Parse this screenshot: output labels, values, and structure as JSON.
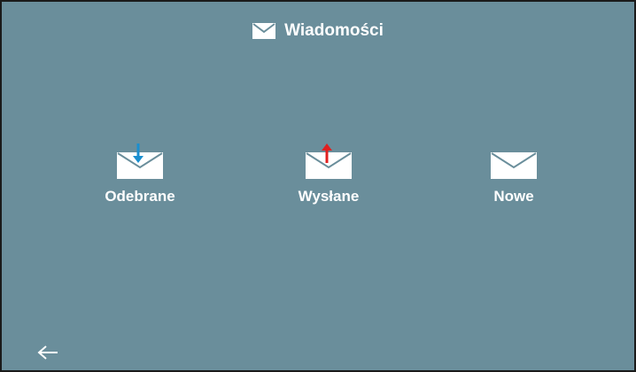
{
  "header": {
    "title": "Wiadomości",
    "icon": "envelope-icon"
  },
  "tiles": [
    {
      "label": "Odebrane",
      "icon": "inbox-envelope-icon",
      "arrow": "down",
      "arrow_color": "#1a8fd0"
    },
    {
      "label": "Wysłane",
      "icon": "sent-envelope-icon",
      "arrow": "up",
      "arrow_color": "#e02020"
    },
    {
      "label": "Nowe",
      "icon": "new-envelope-icon",
      "arrow": "none"
    }
  ],
  "footer": {
    "back_icon": "arrow-left-icon"
  },
  "colors": {
    "background": "#6a8e9b",
    "text": "#ffffff",
    "border": "#1a1a1a"
  }
}
